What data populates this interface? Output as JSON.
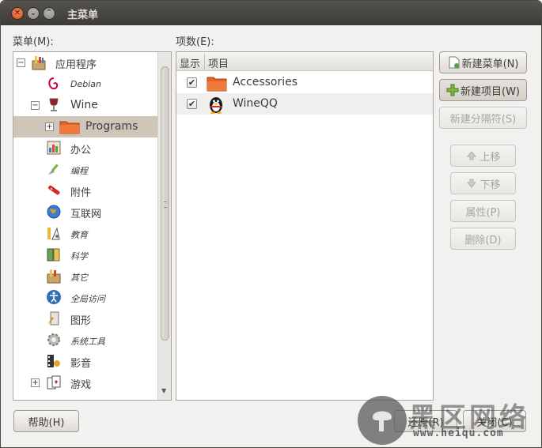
{
  "window": {
    "title": "主菜单",
    "close_glyph": "✕",
    "minimize_glyph": "⌄",
    "maximize_glyph": "⌃"
  },
  "left_panel": {
    "label": "菜单(M):",
    "items": [
      {
        "label": "应用程序",
        "icon": "applications-icon",
        "expander": "−",
        "style": "normal"
      },
      {
        "label": "Debian",
        "icon": "debian-swirl-icon",
        "expander": "",
        "style": "small"
      },
      {
        "label": "Wine",
        "icon": "wine-glass-icon",
        "expander": "−",
        "style": "big"
      },
      {
        "label": "Programs",
        "icon": "folder-icon",
        "expander": "+",
        "style": "big"
      },
      {
        "label": "办公",
        "icon": "office-icon",
        "expander": "",
        "style": "normal"
      },
      {
        "label": "编程",
        "icon": "programming-trowel-icon",
        "expander": "",
        "style": "small"
      },
      {
        "label": "附件",
        "icon": "accessories-knife-icon",
        "expander": "",
        "style": "normal"
      },
      {
        "label": "互联网",
        "icon": "internet-globe-icon",
        "expander": "",
        "style": "normal"
      },
      {
        "label": "教育",
        "icon": "education-icon",
        "expander": "",
        "style": "small"
      },
      {
        "label": "科学",
        "icon": "science-icon",
        "expander": "",
        "style": "small"
      },
      {
        "label": "其它",
        "icon": "other-icon",
        "expander": "",
        "style": "small"
      },
      {
        "label": "全局访问",
        "icon": "accessibility-icon",
        "expander": "",
        "style": "small"
      },
      {
        "label": "图形",
        "icon": "graphics-icon",
        "expander": "",
        "style": "normal"
      },
      {
        "label": "系统工具",
        "icon": "system-tools-gear-icon",
        "expander": "",
        "style": "small"
      },
      {
        "label": "影音",
        "icon": "multimedia-icon",
        "expander": "",
        "style": "normal"
      },
      {
        "label": "游戏",
        "icon": "games-cards-icon",
        "expander": "+",
        "style": "normal"
      }
    ],
    "selected_index": 3,
    "scroll_up": "▲",
    "scroll_down": "▼"
  },
  "right_panel": {
    "label": "项数(E):",
    "columns": [
      "显示",
      "项目"
    ],
    "rows": [
      {
        "shown": true,
        "check": "✔",
        "name": "Accessories",
        "icon": "folder-icon"
      },
      {
        "shown": true,
        "check": "✔",
        "name": "WineQQ",
        "icon": "qq-penguin-icon"
      }
    ]
  },
  "buttons": {
    "new_menu": "新建菜单(N)",
    "new_item": "新建项目(W)",
    "new_separator": "新建分隔符(S)",
    "move_up": "上移",
    "move_down": "下移",
    "properties": "属性(P)",
    "delete": "删除(D)",
    "help": "帮助(H)",
    "revert": "还原(R)",
    "close": "关闭(C)"
  },
  "watermark": {
    "text": "黑区网络",
    "url": "www.heiqu.com"
  },
  "colors": {
    "titlebar": "#3c3b37",
    "window_bg": "#f2f1f0",
    "selected_row": "#cfc6b9",
    "folder_orange": "#e8622a"
  }
}
